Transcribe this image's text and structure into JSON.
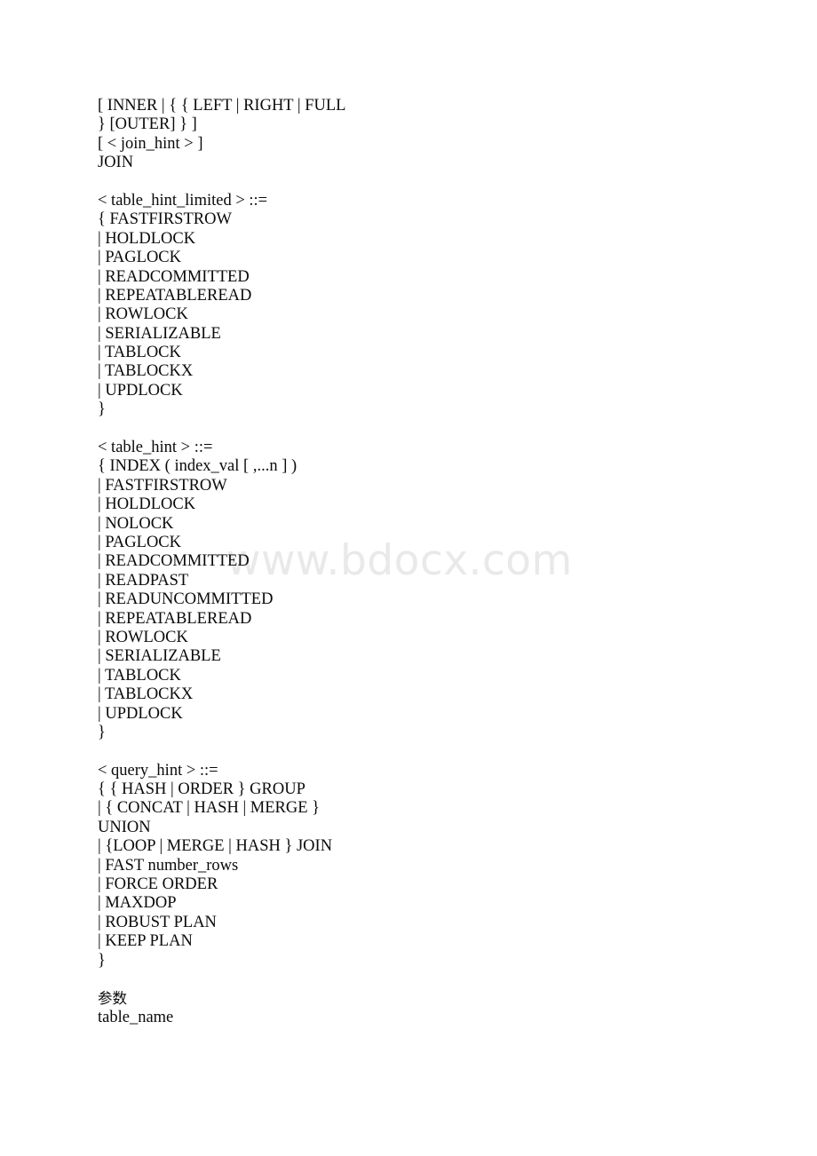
{
  "document": {
    "page_background": "#ffffff",
    "text_color": "#0a0a0a",
    "watermark": {
      "text": "www.bdocx.com",
      "color": "#e9e9e9"
    },
    "blocks": [
      {
        "name": "join-clause-block",
        "lines": [
          "[ INNER | { { LEFT | RIGHT | FULL",
          "} [OUTER] } ]",
          "[ < join_hint > ]",
          "JOIN"
        ]
      },
      {
        "name": "table-hint-limited-block",
        "lines": [
          "< table_hint_limited > ::=",
          "{ FASTFIRSTROW",
          "| HOLDLOCK",
          "| PAGLOCK",
          "| READCOMMITTED",
          "| REPEATABLEREAD",
          "| ROWLOCK",
          "| SERIALIZABLE",
          "| TABLOCK",
          "| TABLOCKX",
          "| UPDLOCK",
          "}"
        ]
      },
      {
        "name": "table-hint-block",
        "lines": [
          "< table_hint > ::=",
          "{ INDEX ( index_val [ ,...n ] )",
          "| FASTFIRSTROW",
          "| HOLDLOCK",
          "| NOLOCK",
          "| PAGLOCK",
          "| READCOMMITTED",
          "| READPAST",
          "| READUNCOMMITTED",
          "| REPEATABLEREAD",
          "| ROWLOCK",
          "| SERIALIZABLE",
          "| TABLOCK",
          "| TABLOCKX",
          "| UPDLOCK",
          "}"
        ]
      },
      {
        "name": "query-hint-block",
        "lines": [
          "< query_hint > ::=",
          "{ { HASH | ORDER } GROUP",
          "| { CONCAT | HASH | MERGE }",
          "UNION",
          "| {LOOP | MERGE | HASH } JOIN",
          "| FAST number_rows",
          "| FORCE ORDER",
          "| MAXDOP",
          "| ROBUST PLAN",
          "| KEEP PLAN",
          "}"
        ]
      },
      {
        "name": "parameters-block",
        "lines": [
          "参数",
          "table_name"
        ],
        "cjk_line_indices": [
          0
        ]
      }
    ]
  }
}
